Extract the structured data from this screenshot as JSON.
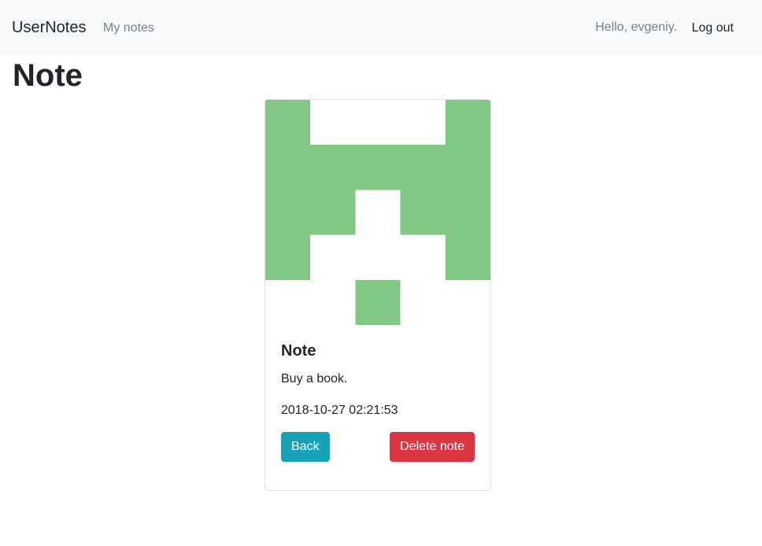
{
  "navbar": {
    "brand": "UserNotes",
    "links": [
      {
        "label": "My notes"
      }
    ],
    "greeting": "Hello, evgeniy.",
    "logout_label": "Log out"
  },
  "page": {
    "title": "Note"
  },
  "note": {
    "title": "Note",
    "text": "Buy a book.",
    "date": "2018-10-27 02:21:53",
    "identicon_color": "#82c884",
    "back_label": "Back",
    "delete_label": "Delete note"
  },
  "colors": {
    "navbar_bg": "#f8f9fa",
    "info": "#17a2b8",
    "danger": "#dc3545"
  }
}
